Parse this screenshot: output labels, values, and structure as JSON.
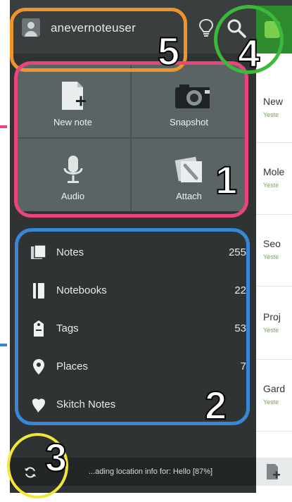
{
  "header": {
    "username": "anevernoteuser"
  },
  "actions": [
    {
      "label": "New note",
      "icon": "new-note-icon"
    },
    {
      "label": "Snapshot",
      "icon": "camera-icon"
    },
    {
      "label": "Audio",
      "icon": "microphone-icon"
    },
    {
      "label": "Attach",
      "icon": "attach-icon"
    }
  ],
  "nav": [
    {
      "label": "Notes",
      "count": "255",
      "icon": "notes-icon"
    },
    {
      "label": "Notebooks",
      "count": "22",
      "icon": "notebook-icon"
    },
    {
      "label": "Tags",
      "count": "53",
      "icon": "tag-icon"
    },
    {
      "label": "Places",
      "count": "7",
      "icon": "place-pin-icon"
    },
    {
      "label": "Skitch Notes",
      "count": "",
      "icon": "skitch-icon"
    }
  ],
  "status": {
    "text": "...ading location info for: Hello [87%]"
  },
  "notes_preview": [
    {
      "title": "New",
      "sub": "Yeste"
    },
    {
      "title": "Mole",
      "sub": "Yeste"
    },
    {
      "title": "Seo",
      "sub": "Yeste"
    },
    {
      "title": "Proj",
      "sub": "Yeste"
    },
    {
      "title": "Gard",
      "sub": "Yeste"
    }
  ],
  "callouts": {
    "n1": "1",
    "n2": "2",
    "n3": "3",
    "n4": "4",
    "n5": "5"
  },
  "colors": {
    "callout_1": "#e8457d",
    "callout_2": "#3a86d6",
    "callout_3": "#f2e63a",
    "callout_4": "#3cb83a",
    "callout_5": "#f0932a",
    "accent_green": "#6cb33f"
  }
}
